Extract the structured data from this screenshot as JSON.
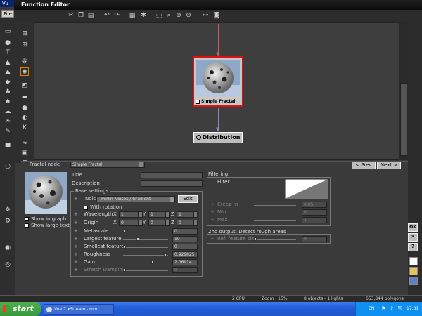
{
  "app": {
    "title": "Vu",
    "window_title": "Function Editor"
  },
  "menu": {
    "file": "File"
  },
  "toolbar": {
    "icons": [
      "cut-icon",
      "copy-icon",
      "paste-icon",
      "undo-icon",
      "redo-icon",
      "grid-icon",
      "zoom-fit-icon",
      "zoom-region-icon",
      "zoom-in-icon",
      "zoom-out-icon",
      "link-icon",
      "snapshot-icon"
    ]
  },
  "canvas": {
    "node": {
      "label": "Simple Fractal"
    },
    "output_node": {
      "label": "Distribution"
    }
  },
  "panel": {
    "node_type_label": "Fractal node",
    "node_type_value": "Simple Fractal",
    "prev_label": "< Prev",
    "next_label": "Next >",
    "show_in_graph": "Show in graph",
    "show_large_text": "Show large text",
    "title_label": "Title",
    "description_label": "Description",
    "base_settings": {
      "title": "Base settings",
      "noise_label": "Noise",
      "noise_value": "Perlin Noises / Gradient",
      "edit_label": "Edit",
      "with_rotation": "With rotation",
      "wavelength_label": "Wavelength",
      "wavelength": {
        "x": "1",
        "y": "1",
        "z": "1"
      },
      "origin_label": "Origin",
      "origin": {
        "x": "0",
        "y": "0",
        "z": "0"
      },
      "axis_x": "X",
      "axis_y": "Y",
      "axis_z": "Z",
      "rows": [
        {
          "label": "Metascale",
          "value": "0",
          "level": 0.0,
          "dim": false
        },
        {
          "label": "Largest feature",
          "value": "10",
          "level": 0.3,
          "dim": false
        },
        {
          "label": "Smallest feature",
          "value": "0",
          "level": 0.0,
          "dim": false
        },
        {
          "label": "Roughness",
          "value": "0.929825",
          "level": 0.9,
          "dim": false
        },
        {
          "label": "Gain",
          "value": "2.06914",
          "level": 0.62,
          "dim": false
        },
        {
          "label": "Stretch Damping",
          "value": "0",
          "level": 0.0,
          "dim": true
        }
      ]
    },
    "filtering": {
      "title": "Filtering",
      "filter_label": "Filter",
      "rows": [
        {
          "label": "Creep in",
          "value": "0.05"
        },
        {
          "label": "Min",
          "value": "0"
        },
        {
          "label": "Max",
          "value": "1"
        }
      ]
    },
    "second_output": {
      "title": "2nd output: Detect rough areas",
      "ref_label": "Ref. feature size",
      "ref_value": "0"
    },
    "side_buttons": {
      "ok": "OK",
      "cancel": "✕",
      "help": "?"
    }
  },
  "status": {
    "cpu": "2 CPU",
    "zoom": "Zoom : 15%",
    "objects": "8 objects - 1 lights",
    "polygons": "653,844 polygons"
  },
  "taskbar": {
    "start": "start",
    "task": "Vue 7 xStream - mou...",
    "lang": "EN",
    "clock": "17:31"
  },
  "colors": {
    "selection": "#dd1111",
    "link": "#c86060",
    "taskbar": "#245edc"
  }
}
